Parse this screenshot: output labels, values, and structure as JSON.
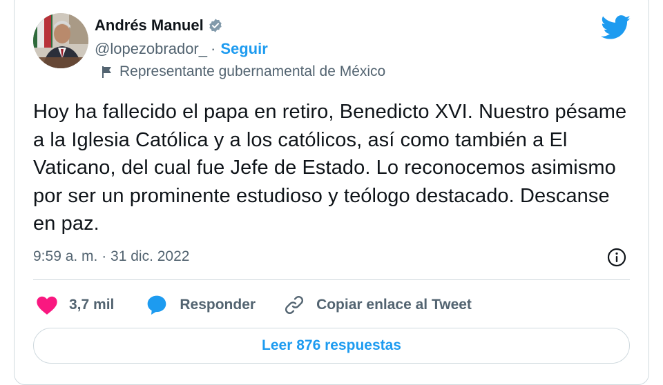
{
  "author": {
    "name": "Andrés Manuel",
    "handle": "@lopezobrador_",
    "separator": "·",
    "follow_label": "Seguir",
    "label": "Representante gubernamental de México"
  },
  "tweet": {
    "text": "Hoy ha fallecido el papa en retiro, Benedicto XVI. Nuestro pésame a la Iglesia Católica y a los católicos, así como también a El Vaticano, del cual fue Jefe de Estado. Lo reconocemos asimismo por ser un prominente estudioso y teólogo destacado. Descanse en paz.",
    "timestamp": "9:59 a. m. · 31 dic. 2022"
  },
  "actions": {
    "likes": "3,7 mil",
    "reply_label": "Responder",
    "copy_link_label": "Copiar enlace al Tweet"
  },
  "replies_button": "Leer 876 respuestas",
  "icons": [
    "verified-badge-icon",
    "flag-icon",
    "twitter-bird-icon",
    "info-icon",
    "heart-icon",
    "reply-bubble-icon",
    "link-icon"
  ],
  "colors": {
    "accent": "#1d9bf0",
    "like": "#f91880",
    "text": "#0f1419",
    "secondary": "#536471",
    "border": "#cfd9de"
  }
}
